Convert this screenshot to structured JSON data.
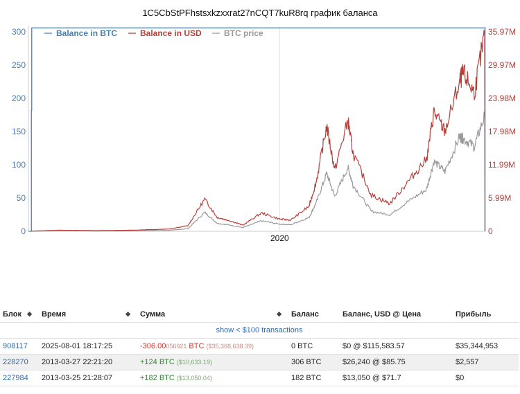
{
  "page": {
    "title": "1C5CbStPFhstsxkzxxrat27nCQT7kuR8rq график баланса"
  },
  "colors": {
    "btc": "#4a7fb5",
    "usd": "#b5413b",
    "price": "#9a9a9a",
    "link": "#2a6bb0"
  },
  "chart_data": {
    "type": "line",
    "title": "1C5CbStPFhstsxkzxxrat27nCQT7kuR8rq график баланса",
    "legend": {
      "placement": "top-left",
      "entries": [
        "Balance in BTC",
        "Balance in USD",
        "BTC price"
      ]
    },
    "x_tick_labels": [
      "2020"
    ],
    "y_left": {
      "ticks": [
        "0",
        "50",
        "100",
        "150",
        "200",
        "250",
        "300"
      ],
      "range": [
        0,
        300
      ]
    },
    "y_right": {
      "ticks": [
        "0",
        "5.99M",
        "11.99M",
        "17.98M",
        "23.98M",
        "29.97M",
        "35.97M"
      ],
      "range": [
        0,
        35970000
      ]
    },
    "grid": false,
    "series": [
      {
        "name": "Balance in BTC",
        "axis": "left",
        "x": [
          2013.16,
          2013.24,
          2013.25,
          2025.58,
          2025.59
        ],
        "values": [
          0,
          182,
          306,
          306,
          0
        ]
      },
      {
        "name": "Balance in USD",
        "axis": "right",
        "x": [
          2013.25,
          2014.0,
          2015.0,
          2016.0,
          2017.0,
          2017.5,
          2017.96,
          2018.3,
          2018.6,
          2019.0,
          2019.5,
          2020.0,
          2020.3,
          2020.8,
          2021.0,
          2021.28,
          2021.5,
          2021.86,
          2022.0,
          2022.5,
          2023.0,
          2023.5,
          2024.0,
          2024.2,
          2024.5,
          2024.9,
          2025.0,
          2025.3,
          2025.58
        ],
        "values": [
          26240,
          200000,
          120000,
          200000,
          400000,
          1000000,
          5800000,
          2500000,
          2000000,
          1100000,
          3300000,
          2200000,
          2000000,
          4500000,
          9000000,
          19000000,
          11000000,
          20000000,
          14000000,
          6500000,
          5000000,
          9000000,
          13000000,
          21500000,
          18000000,
          27000000,
          28500000,
          25000000,
          35370000
        ]
      },
      {
        "name": "BTC price",
        "axis": "right",
        "x": [
          2013.25,
          2014.0,
          2015.0,
          2016.0,
          2017.0,
          2017.5,
          2017.96,
          2018.3,
          2018.6,
          2019.0,
          2019.5,
          2020.0,
          2020.3,
          2020.8,
          2021.0,
          2021.28,
          2021.5,
          2021.86,
          2022.0,
          2022.5,
          2023.0,
          2023.5,
          2024.0,
          2024.2,
          2024.5,
          2024.9,
          2025.0,
          2025.3,
          2025.58
        ],
        "values": [
          86,
          600,
          300,
          400,
          1000,
          2500,
          19000,
          8000,
          6500,
          3700,
          10500,
          7200,
          6500,
          13800,
          29000,
          58000,
          35000,
          64000,
          46000,
          20000,
          16500,
          30000,
          42000,
          70000,
          60000,
          95000,
          93000,
          85000,
          115583
        ]
      }
    ]
  },
  "table": {
    "headers": [
      "Блок",
      "Время",
      "Сумма",
      "Баланс",
      "Баланс, USD @ Цена",
      "Прибыль"
    ],
    "sort_icon": "◆",
    "filter_link": "show < $100 transactions",
    "rows": [
      {
        "block": "908117",
        "time": "2025-08-01 18:17:25",
        "amount_main": "-306.00",
        "amount_tail": "056921",
        "amount_unit": "BTC",
        "amount_usd": "($35,368,638.39)",
        "sign": "neg",
        "balance": "0 BTC",
        "balance_usd": "$0 @ $115,583.57",
        "profit": "$35,344,953"
      },
      {
        "block": "228270",
        "time": "2013-03-27 22:21:20",
        "amount_main": "+124",
        "amount_tail": "",
        "amount_unit": "BTC",
        "amount_usd": "($10,633.19)",
        "sign": "pos",
        "balance": "306 BTC",
        "balance_usd": "$26,240 @ $85.75",
        "profit": "$2,557"
      },
      {
        "block": "227984",
        "time": "2013-03-25 21:28:07",
        "amount_main": "+182",
        "amount_tail": "",
        "amount_unit": "BTC",
        "amount_usd": "($13,050.04)",
        "sign": "pos",
        "balance": "182 BTC",
        "balance_usd": "$13,050 @ $71.7",
        "profit": "$0"
      }
    ]
  }
}
